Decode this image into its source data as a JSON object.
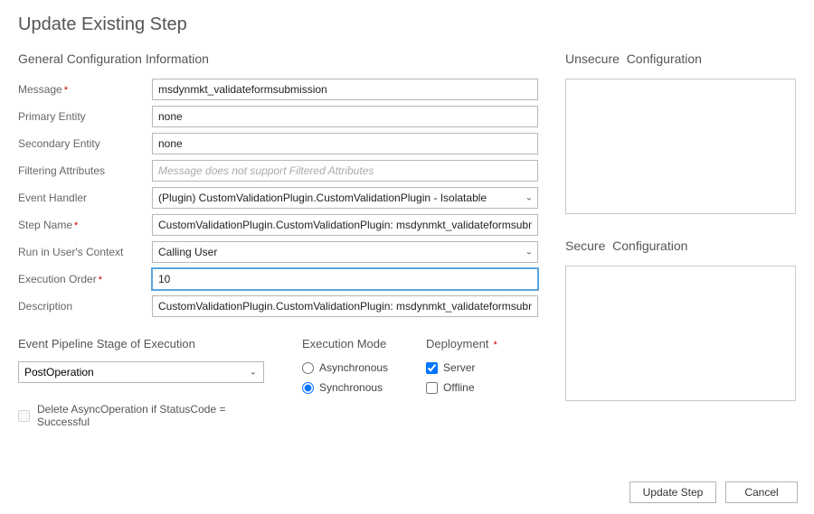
{
  "title": "Update Existing Step",
  "section_general": "General Configuration Information",
  "labels": {
    "message": "Message",
    "primary_entity": "Primary Entity",
    "secondary_entity": "Secondary Entity",
    "filtering_attributes": "Filtering Attributes",
    "event_handler": "Event Handler",
    "step_name": "Step Name",
    "run_ctx": "Run in User's Context",
    "execution_order": "Execution Order",
    "description": "Description"
  },
  "values": {
    "message": "msdynmkt_validateformsubmission",
    "primary_entity": "none",
    "secondary_entity": "none",
    "filtering_attributes_placeholder": "Message does not support Filtered Attributes",
    "event_handler": "(Plugin) CustomValidationPlugin.CustomValidationPlugin - Isolatable",
    "step_name": "CustomValidationPlugin.CustomValidationPlugin: msdynmkt_validateformsubmission of any Entity",
    "run_ctx": "Calling User",
    "execution_order": "10",
    "description": "CustomValidationPlugin.CustomValidationPlugin: msdynmkt_validateformsubmission of any Entity"
  },
  "pipeline": {
    "section": "Event Pipeline Stage of Execution",
    "stage": "PostOperation",
    "exec_mode_title": "Execution Mode",
    "exec_async": "Asynchronous",
    "exec_sync": "Synchronous",
    "deployment_title": "Deployment",
    "dep_server": "Server",
    "dep_offline": "Offline"
  },
  "delete_async_label": "Delete AsyncOperation if StatusCode = Successful",
  "unsecure_title": "Unsecure  Configuration",
  "secure_title": "Secure  Configuration",
  "buttons": {
    "update": "Update Step",
    "cancel": "Cancel"
  }
}
